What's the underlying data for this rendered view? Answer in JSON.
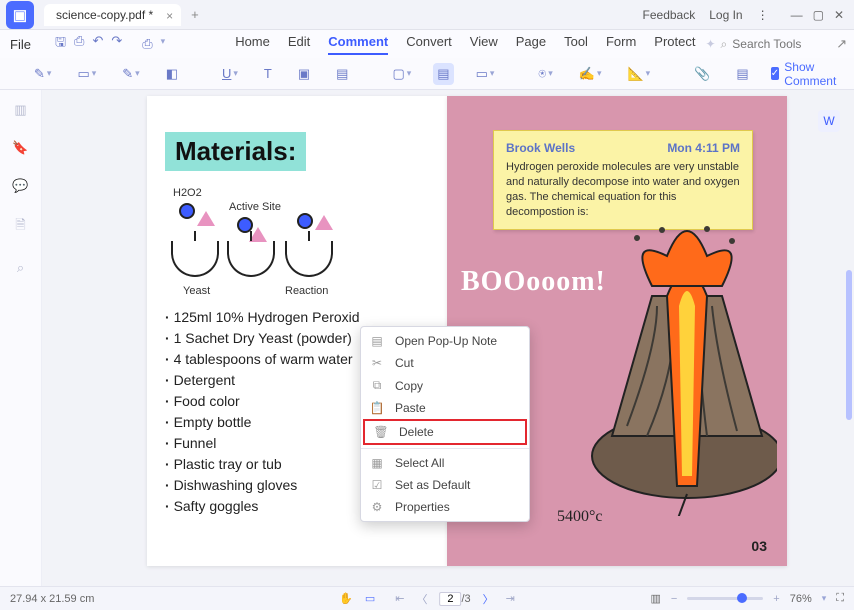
{
  "titlebar": {
    "tab": "science-copy.pdf *",
    "feedback": "Feedback",
    "login": "Log In"
  },
  "menubar": {
    "file": "File",
    "tabs": [
      "Home",
      "Edit",
      "Comment",
      "Convert",
      "View",
      "Page",
      "Tool",
      "Form",
      "Protect"
    ],
    "active_index": 2,
    "search_placeholder": "Search Tools"
  },
  "toolbar": {
    "show_comment": "Show Comment"
  },
  "doc": {
    "materials_title": "Materials:",
    "diagram_labels": {
      "h2o2": "H2O2",
      "active_site": "Active Site",
      "yeast": "Yeast",
      "reaction": "Reaction"
    },
    "materials": [
      "125ml 10% Hydrogen Peroxid",
      "1 Sachet Dry Yeast (powder)",
      "4 tablespoons of warm water",
      "Detergent",
      "Food color",
      "Empty bottle",
      "Funnel",
      "Plastic tray or tub",
      "Dishwashing gloves",
      "Safty goggles"
    ],
    "boom": "BOOooom!",
    "temp": "5400°c",
    "page_number": "03"
  },
  "comment": {
    "author": "Brook Wells",
    "time": "Mon 4:11 PM",
    "body": "Hydrogen peroxide molecules are very unstable and naturally decompose into water and oxygen gas. The chemical equation for this decompostion is:"
  },
  "ctx": {
    "open": "Open Pop-Up Note",
    "cut": "Cut",
    "copy": "Copy",
    "paste": "Paste",
    "delete": "Delete",
    "select_all": "Select All",
    "set_default": "Set as Default",
    "properties": "Properties"
  },
  "status": {
    "dims": "27.94 x 21.59 cm",
    "page_current": "2",
    "page_total": "/3",
    "zoom": "76%"
  }
}
